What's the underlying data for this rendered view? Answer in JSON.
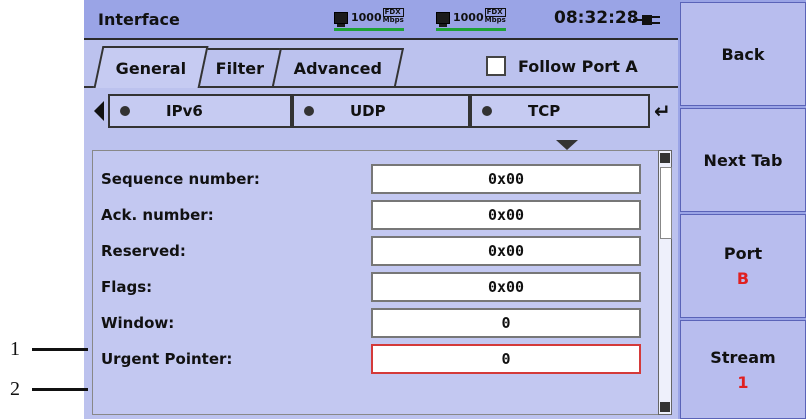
{
  "header": {
    "title": "Interface",
    "port_a": {
      "speed": "1000",
      "duplex_top": "FDX",
      "duplex_bottom": "Mbps"
    },
    "port_b": {
      "speed": "1000",
      "duplex_top": "FDX",
      "duplex_bottom": "Mbps"
    },
    "time": "08:32:28",
    "power_icon": "plug-icon",
    "link_color": "#1ea236"
  },
  "tabs": [
    {
      "label": "General",
      "active": true
    },
    {
      "label": "Filter",
      "active": false
    },
    {
      "label": "Advanced",
      "active": false
    }
  ],
  "follow_port": {
    "label": "Follow Port A",
    "checked": false
  },
  "protocols": [
    {
      "label": "IPv6"
    },
    {
      "label": "UDP"
    },
    {
      "label": "TCP"
    }
  ],
  "fields": [
    {
      "label": "Sequence number:",
      "value": "0x00"
    },
    {
      "label": "Ack. number:",
      "value": "0x00"
    },
    {
      "label": "Reserved:",
      "value": "0x00"
    },
    {
      "label": "Flags:",
      "value": "0x00"
    },
    {
      "label": "Window:",
      "value": "0"
    },
    {
      "label": "Urgent Pointer:",
      "value": "0",
      "selected": true
    }
  ],
  "softkeys": {
    "back": "Back",
    "next_tab": "Next Tab",
    "port": {
      "label": "Port",
      "value": "B"
    },
    "stream": {
      "label": "Stream",
      "value": "1"
    }
  },
  "callouts": [
    "1",
    "2"
  ],
  "colors": {
    "selection_border": "#d43a3a",
    "softkey_value": "#e02020"
  }
}
